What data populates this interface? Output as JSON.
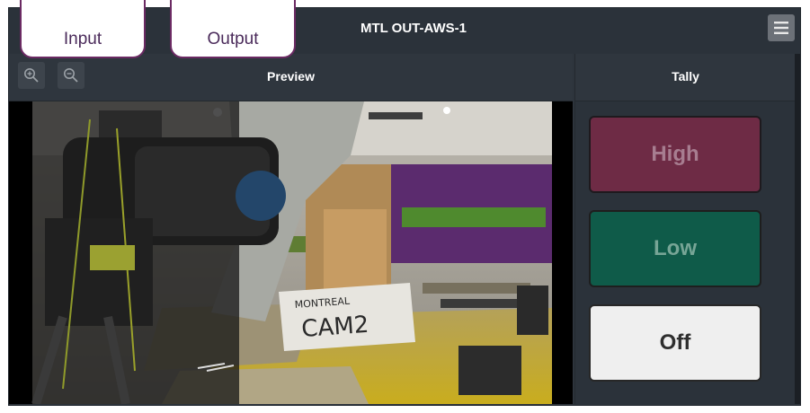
{
  "window": {
    "title": "MTL OUT-AWS-1"
  },
  "tabs": [
    {
      "label": "Input"
    },
    {
      "label": "Output"
    }
  ],
  "preview": {
    "title": "Preview",
    "video_sign_text": [
      "MONTREAL",
      "CAM2"
    ]
  },
  "tally": {
    "title": "Tally",
    "buttons": [
      {
        "label": "High"
      },
      {
        "label": "Low"
      },
      {
        "label": "Off"
      }
    ]
  },
  "icons": {
    "menu": "hamburger-icon",
    "zoom_in": "zoom-in-icon",
    "zoom_out": "zoom-out-icon"
  },
  "colors": {
    "high": "#6e2b45",
    "low": "#0f5b49",
    "off": "#efefef",
    "tab_border": "#6b2a63"
  }
}
